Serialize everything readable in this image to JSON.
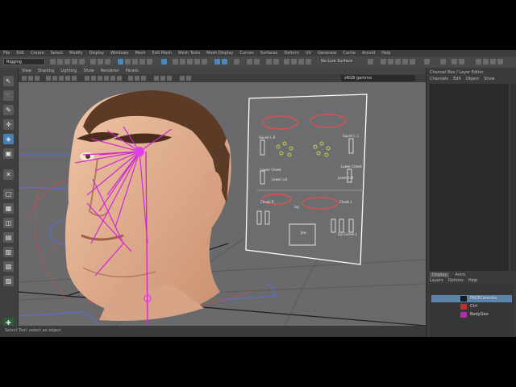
{
  "menubar": [
    "File",
    "Edit",
    "Create",
    "Select",
    "Modify",
    "Display",
    "Windows",
    "Mesh",
    "Edit Mesh",
    "Mesh Tools",
    "Mesh Display",
    "Curves",
    "Surfaces",
    "Deform",
    "UV",
    "Generate",
    "Cache",
    "Arnold",
    "Help"
  ],
  "shelf": {
    "mode": "Rigging",
    "symmetry": "No Live Surface"
  },
  "viewport": {
    "menu": [
      "View",
      "Shading",
      "Lighting",
      "Show",
      "Renderer",
      "Panels"
    ],
    "color_space": "sRGB gamma"
  },
  "face_picker": {
    "labels": [
      "Squint L R",
      "Squint L L",
      "Lower Cheek",
      "Lower Cheek",
      "Lower Lid",
      "Lower Lid",
      "Cheek R",
      "Cheek L",
      "Lip",
      "Jaw",
      "Lip Corner L"
    ]
  },
  "right_panel": {
    "top_tabs": [
      "Channel Box / Layer Editor"
    ],
    "sub_tabs": [
      "Channels",
      "Edit",
      "Object",
      "Show"
    ],
    "layer_tabs": [
      "Display",
      "Anim"
    ],
    "layer_menu": [
      "Layers",
      "Options",
      "Help"
    ],
    "layers": [
      {
        "name": "FACEControls",
        "color": "#1a1a1a",
        "selected": true
      },
      {
        "name": "Ctrl",
        "color": "#c03030",
        "selected": false
      },
      {
        "name": "BodyGeo",
        "color": "#b02fa8",
        "selected": false
      }
    ]
  },
  "status": {
    "help": "Select Tool: select an object"
  }
}
